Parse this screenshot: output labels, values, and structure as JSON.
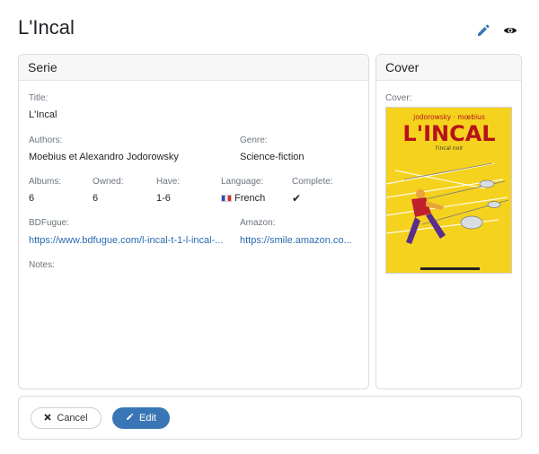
{
  "page": {
    "title": "L'Incal"
  },
  "actions": {
    "edit_icon": "pencil-icon",
    "view_icon": "eye-icon"
  },
  "serie": {
    "header": "Serie",
    "title_label": "Title:",
    "title_value": "L'Incal",
    "authors_label": "Authors:",
    "authors_value": "Moebius et Alexandro Jodorowsky",
    "genre_label": "Genre:",
    "genre_value": "Science-fiction",
    "albums_label": "Albums:",
    "albums_value": "6",
    "owned_label": "Owned:",
    "owned_value": "6",
    "have_label": "Have:",
    "have_value": "1-6",
    "language_label": "Language:",
    "language_value": "French",
    "complete_label": "Complete:",
    "complete_value": "✔",
    "bdfugue_label": "BDFugue:",
    "bdfugue_value": "https://www.bdfugue.com/l-incal-t-1-l-incal-...",
    "amazon_label": "Amazon:",
    "amazon_value": "https://smile.amazon.co...",
    "notes_label": "Notes:"
  },
  "cover": {
    "header": "Cover",
    "label": "Cover:",
    "authors_text": "jodorowsky · mœbius",
    "title_text": "L'INCAL",
    "subtitle_text": "l'incal noir"
  },
  "footer": {
    "cancel_label": "Cancel",
    "edit_label": "Edit"
  },
  "colors": {
    "accent": "#3a76b5",
    "link": "#2a6bb0",
    "cover_bg": "#f5d21e"
  }
}
